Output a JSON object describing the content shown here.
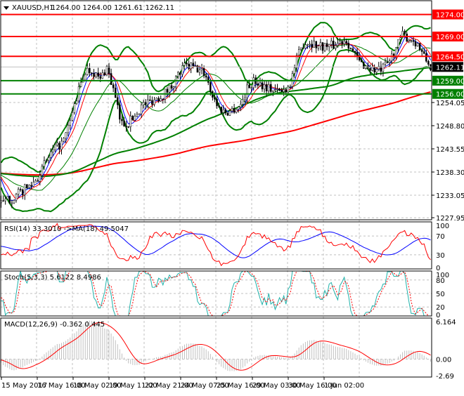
{
  "header": {
    "symbol": "XAUUSD,H1",
    "ohlc": "1264.00 1264.00 1261.61 1262.11",
    "menu_icon": "triangle-down-icon"
  },
  "colors": {
    "support": "#008000",
    "resistance": "#ff0000",
    "bollinger": "#008000",
    "ma_long": "#ff0000",
    "ma_mid": "#008000",
    "ma_fast": "#0000ff",
    "rsi": "#ff0000",
    "rsi_ma": "#0000ff",
    "stoch_k": "#20b2aa",
    "stoch_d": "#ff0000",
    "macd_hist": "#c0c0c0",
    "macd_signal": "#ff0000"
  },
  "chart_data": [
    {
      "type": "candlestick",
      "title": "XAUUSD,H1",
      "timeframe": "H1",
      "last_price": "1262.11",
      "ylim": [
        1227.95,
        1276.5
      ],
      "y_ticks": [
        "1254.05",
        "1248.80",
        "1243.55",
        "1238.30",
        "1233.05",
        "1227.95"
      ],
      "x_ticks": [
        "15 May 2017",
        "16 May 16:00",
        "18 May 02:00",
        "19 May 11:00",
        "22 May 21:00",
        "24 May 07:00",
        "25 May 16:00",
        "29 May 03:00",
        "30 May 16:00",
        "1 Jun 02:00"
      ],
      "approx_close": [
        1231.1,
        1232.0,
        1232.7,
        1234.0,
        1235.1,
        1236.7,
        1239.5,
        1242.3,
        1243.9,
        1245.5,
        1251.0,
        1256.6,
        1261.4,
        1261.4,
        1259.0,
        1262.2,
        1256.6,
        1249.4,
        1249.4,
        1251.0,
        1253.4,
        1254.2,
        1255.0,
        1255.8,
        1257.4,
        1259.8,
        1262.2,
        1262.2,
        1261.4,
        1260.6,
        1255.8,
        1252.6,
        1251.8,
        1252.6,
        1253.4,
        1257.4,
        1259.0,
        1258.2,
        1257.4,
        1256.6,
        1256.6,
        1258.2,
        1263.8,
        1267.7,
        1267.7,
        1266.9,
        1266.9,
        1266.9,
        1267.7,
        1268.5,
        1265.3,
        1263.0,
        1262.2,
        1261.4,
        1261.4,
        1263.0,
        1266.1,
        1269.3,
        1268.5,
        1267.7,
        1264.5,
        1262.1
      ],
      "levels": [
        {
          "price": 1274.0,
          "label": "1274.00",
          "kind": "resistance"
        },
        {
          "price": 1269.0,
          "label": "1269.00",
          "kind": "resistance"
        },
        {
          "price": 1264.5,
          "label": "1264.50",
          "kind": "resistance"
        },
        {
          "price": 1259.0,
          "label": "1259.00",
          "kind": "support"
        },
        {
          "price": 1256.0,
          "label": "1256.00",
          "kind": "support"
        }
      ],
      "overlays": [
        "Bollinger Bands",
        "Moving averages"
      ]
    },
    {
      "type": "line",
      "title": "RSI(14) 33.3010  ->MA(18) 49.5047",
      "ylim": [
        0,
        100
      ],
      "y_ticks": [
        "100",
        "70",
        "30",
        "0"
      ]
    },
    {
      "type": "line",
      "title": "Stoch(5,3,3) 5.6122 8.4986",
      "ylim": [
        0,
        100
      ],
      "y_ticks": [
        "100",
        "80",
        "50",
        "20",
        "0"
      ]
    },
    {
      "type": "bar",
      "title": "MACD(12,26,9) -0.362 0.445",
      "ylim": [
        -2.69,
        6.164
      ],
      "y_ticks": [
        "6.164",
        "0.00",
        "-2.69"
      ]
    }
  ]
}
